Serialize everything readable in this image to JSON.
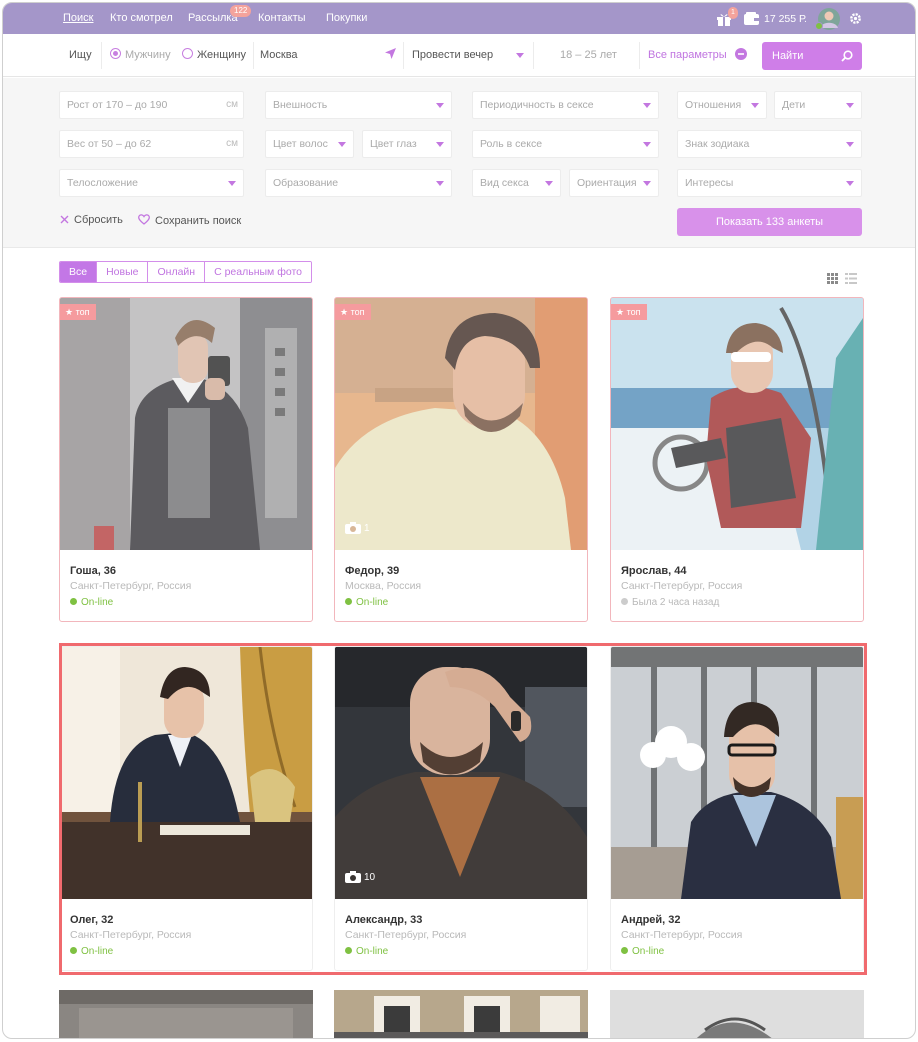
{
  "topbar": {
    "nav": [
      "Поиск",
      "Кто смотрел",
      "Рассылка",
      "Контакты",
      "Покупки"
    ],
    "mailing_badge": "122",
    "gift_badge": "1",
    "balance": "17 255 Р."
  },
  "searchbar": {
    "seeking_label": "Ищу",
    "gender_male": "Мужчину",
    "gender_female": "Женщину",
    "city": "Москва",
    "goal": "Провести вечер",
    "age": "18 – 25 лет",
    "all_params": "Все параметры",
    "find": "Найти"
  },
  "filters": {
    "height": "Рост от 170 – до 190",
    "height_unit": "см",
    "weight": "Вес от 50 – до 62",
    "weight_unit": "см",
    "body": "Телосложение",
    "appearance": "Внешность",
    "hair": "Цвет волос",
    "eyes": "Цвет глаз",
    "education": "Образование",
    "frequency": "Периодичность в сексе",
    "role": "Роль в сексе",
    "sex_type": "Вид секса",
    "orientation": "Ориентация",
    "relations": "Отношения",
    "children": "Дети",
    "zodiac": "Знак зодиака",
    "interests": "Интересы",
    "reset": "Сбросить",
    "save_search": "Сохранить поиск",
    "show_button": "Показать 133 анкеты"
  },
  "tabs": [
    "Все",
    "Новые",
    "Онлайн",
    "С реальным фото"
  ],
  "top_label": "топ",
  "profiles": [
    {
      "name": "Гоша, 36",
      "city": "Санкт-Петербург, Россия",
      "status": "On-line",
      "online": true,
      "top": true,
      "photos": ""
    },
    {
      "name": "Федор, 39",
      "city": "Москва, Россия",
      "status": "On-line",
      "online": true,
      "top": true,
      "photos": "1"
    },
    {
      "name": "Ярослав, 44",
      "city": "Санкт-Петербург, Россия",
      "status": "Была 2 часа назад",
      "online": false,
      "top": true,
      "photos": ""
    },
    {
      "name": "Олег, 32",
      "city": "Санкт-Петербург, Россия",
      "status": "On-line",
      "online": true,
      "top": false,
      "photos": ""
    },
    {
      "name": "Александр, 33",
      "city": "Санкт-Петербург, Россия",
      "status": "On-line",
      "online": true,
      "top": false,
      "photos": "10"
    },
    {
      "name": "Андрей, 32",
      "city": "Санкт-Петербург, Россия",
      "status": "On-line",
      "online": true,
      "top": false,
      "photos": ""
    }
  ],
  "colors": {
    "accent": "#c377e6",
    "topbar": "#a496c9",
    "top_badge": "#f59b9e",
    "online": "#7fc142",
    "highlight": "#f06a6e"
  }
}
